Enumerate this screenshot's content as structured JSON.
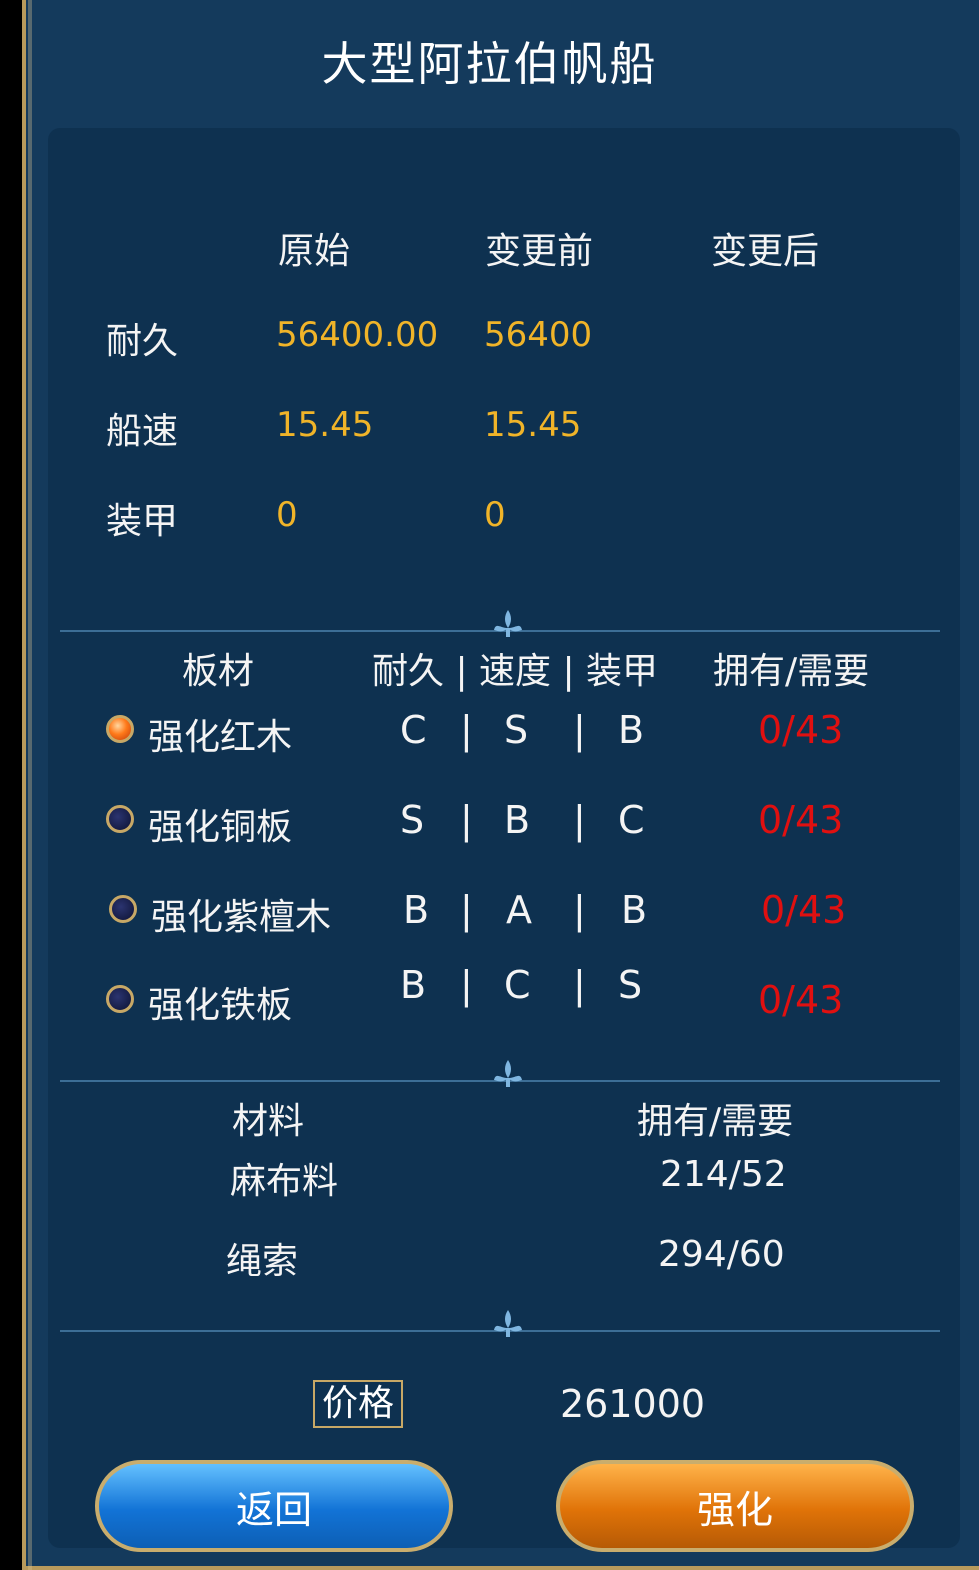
{
  "title": "大型阿拉伯帆船",
  "stats": {
    "headers": [
      "原始",
      "变更前",
      "变更后"
    ],
    "rows": [
      {
        "label": "耐久",
        "original": "56400.00",
        "before": "56400",
        "after": ""
      },
      {
        "label": "船速",
        "original": "15.45",
        "before": "15.45",
        "after": ""
      },
      {
        "label": "装甲",
        "original": "0",
        "before": "0",
        "after": ""
      }
    ]
  },
  "boards": {
    "headers": {
      "material": "板材",
      "attrs": "耐久 | 速度 | 装甲",
      "own": "拥有/需要"
    },
    "separator": "|",
    "items": [
      {
        "name": "强化红木",
        "dur": "C",
        "speed": "S",
        "armor": "B",
        "own": "0/43",
        "selected": true
      },
      {
        "name": "强化铜板",
        "dur": "S",
        "speed": "B",
        "armor": "C",
        "own": "0/43",
        "selected": false
      },
      {
        "name": "强化紫檀木",
        "dur": "B",
        "speed": "A",
        "armor": "B",
        "own": "0/43",
        "selected": false
      },
      {
        "name": "强化铁板",
        "dur": "B",
        "speed": "C",
        "armor": "S",
        "own": "0/43",
        "selected": false
      }
    ]
  },
  "materials": {
    "headers": {
      "material": "材料",
      "own": "拥有/需要"
    },
    "items": [
      {
        "name": "麻布料",
        "own": "214/52"
      },
      {
        "name": "绳索",
        "own": "294/60"
      }
    ]
  },
  "price": {
    "label": "价格",
    "value": "261000"
  },
  "buttons": {
    "back": "返回",
    "upgrade": "强化"
  },
  "colors": {
    "value_gold": "#f0b429",
    "shortage_red": "#e01010",
    "panel": "#0e3150"
  }
}
